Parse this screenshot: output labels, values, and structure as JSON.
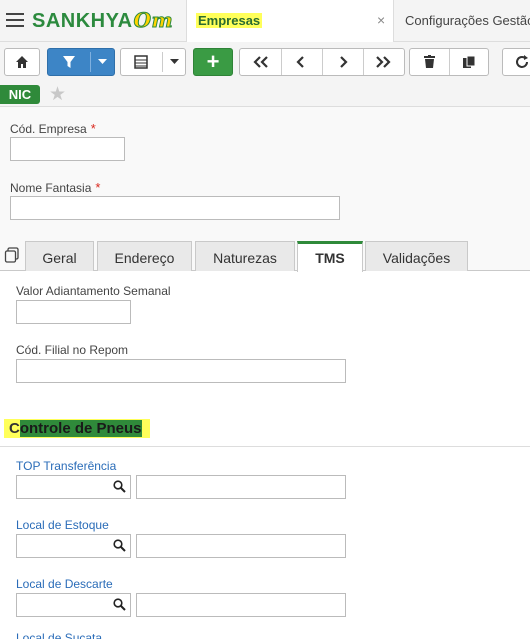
{
  "app": {
    "brand_main": "SANKHYA",
    "brand_suffix": "Om",
    "tabs": [
      {
        "label": "Empresas",
        "close": "×"
      },
      {
        "label": "Configurações Gestão"
      }
    ]
  },
  "toolbar": {
    "icons": [
      "home-icon",
      "filter-icon",
      "grid-icon",
      "add-icon",
      "first-icon",
      "prev-icon",
      "next-icon",
      "last-icon",
      "trash-icon",
      "copy-icon",
      "refresh-icon"
    ],
    "add_label": "+"
  },
  "record": {
    "badge": "NIC",
    "star": "★"
  },
  "form": {
    "cod_empresa_label": "Cód. Empresa",
    "nome_fantasia_label": "Nome Fantasia",
    "required_mark": "*",
    "cod_empresa_value": "",
    "nome_fantasia_value": ""
  },
  "tabs": [
    {
      "label": "Geral"
    },
    {
      "label": "Endereço"
    },
    {
      "label": "Naturezas"
    },
    {
      "label": "TMS",
      "active": true
    },
    {
      "label": "Validações"
    }
  ],
  "tms": {
    "valor_adiantamento_label": "Valor Adiantamento Semanal",
    "cod_filial_label": "Cód. Filial no Repom",
    "section_first": "C",
    "section_rest": "ontrole de Pneus",
    "top_transferencia_label": "TOP Transferência",
    "local_estoque_label": "Local de Estoque",
    "local_descarte_label": "Local de Descarte",
    "cut_label": "Local de Sucata"
  },
  "colors": {
    "brand_green": "#2f8a3a",
    "highlight_yellow": "#ffff5a",
    "filter_blue": "#3d85c6",
    "required_red": "#d9261c",
    "link_blue": "#2a6cb8"
  }
}
